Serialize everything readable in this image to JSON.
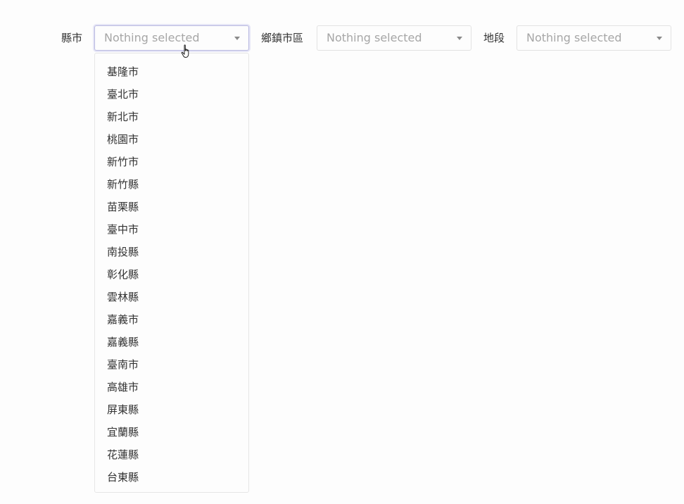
{
  "filters": {
    "county": {
      "label": "縣市",
      "value": "Nothing selected"
    },
    "township": {
      "label": "鄉鎮市區",
      "value": "Nothing selected"
    },
    "section": {
      "label": "地段",
      "value": "Nothing selected"
    }
  },
  "county_dropdown": {
    "open": true,
    "options": [
      "基隆市",
      "臺北市",
      "新北市",
      "桃園市",
      "新竹市",
      "新竹縣",
      "苗栗縣",
      "臺中市",
      "南投縣",
      "彰化縣",
      "雲林縣",
      "嘉義市",
      "嘉義縣",
      "臺南市",
      "高雄市",
      "屏東縣",
      "宜蘭縣",
      "花蓮縣",
      "台東縣"
    ]
  },
  "cursor": {
    "icon": "hand-pointer-icon"
  }
}
